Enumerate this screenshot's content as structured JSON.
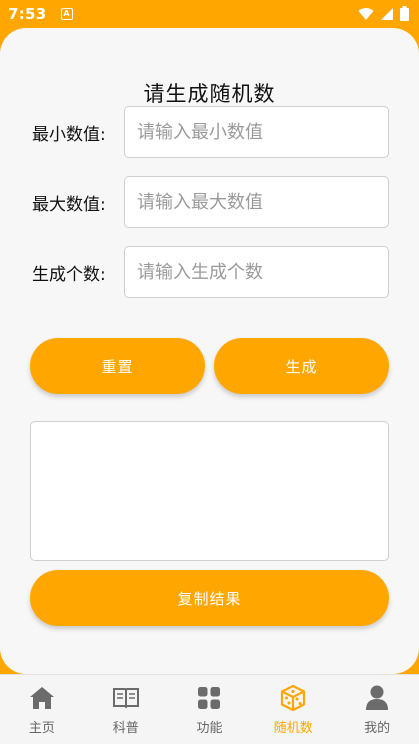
{
  "status_bar": {
    "time": "7:53",
    "notification_letter": "A"
  },
  "page": {
    "title": "请生成随机数"
  },
  "form": {
    "min": {
      "label": "最小数值:",
      "placeholder": "请输入最小数值",
      "value": ""
    },
    "max": {
      "label": "最大数值:",
      "placeholder": "请输入最大数值",
      "value": ""
    },
    "count": {
      "label": "生成个数:",
      "placeholder": "请输入生成个数",
      "value": ""
    }
  },
  "buttons": {
    "reset": "重置",
    "generate": "生成",
    "copy": "复制结果"
  },
  "result": {
    "value": ""
  },
  "nav": {
    "items": [
      {
        "label": "主页",
        "icon": "home-icon"
      },
      {
        "label": "科普",
        "icon": "book-icon"
      },
      {
        "label": "功能",
        "icon": "grid-icon"
      },
      {
        "label": "随机数",
        "icon": "dice-icon",
        "active": true
      },
      {
        "label": "我的",
        "icon": "user-icon"
      }
    ]
  },
  "colors": {
    "accent": "#ffa600",
    "nav_inactive": "#6b6b6b",
    "card_bg": "#f7f7f7"
  }
}
